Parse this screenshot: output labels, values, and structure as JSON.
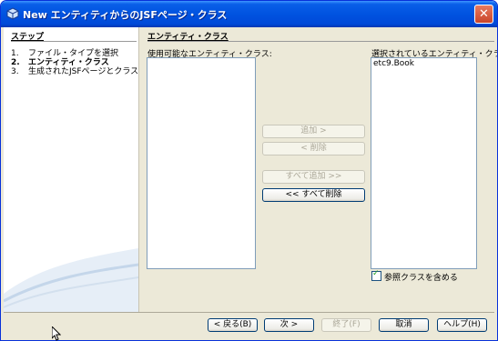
{
  "window": {
    "title": "New エンティティからのJSFページ・クラス",
    "close_glyph": "✕"
  },
  "steps": {
    "title": "ステップ",
    "items": [
      {
        "num": "1.",
        "label": "ファイル・タイプを選択"
      },
      {
        "num": "2.",
        "label": "エンティティ・クラス"
      },
      {
        "num": "3.",
        "label": "生成されたJSFページとクラス"
      }
    ]
  },
  "content": {
    "title": "エンティティ・クラス",
    "available_label": "使用可能なエンティティ・クラス:",
    "available_items": [],
    "selected_label": "選択されているエンティティ・クラス:",
    "selected_items": [
      "etc9.Book"
    ],
    "buttons": {
      "add": "追加 >",
      "remove": "< 削除",
      "add_all": "すべて追加 >>",
      "remove_all": "<< すべて削除"
    },
    "include_referenced": {
      "label": "参照クラスを含める",
      "checked": true
    }
  },
  "footer": {
    "back": "< 戻る(B)",
    "next": "次 >",
    "finish": "終了(F)",
    "cancel": "取消",
    "help": "ヘルプ(H)"
  },
  "colors": {
    "titlebar": "#0053e0",
    "dialog_bg": "#ece9d8",
    "list_border": "#7f9db9",
    "check": "#21a121"
  }
}
